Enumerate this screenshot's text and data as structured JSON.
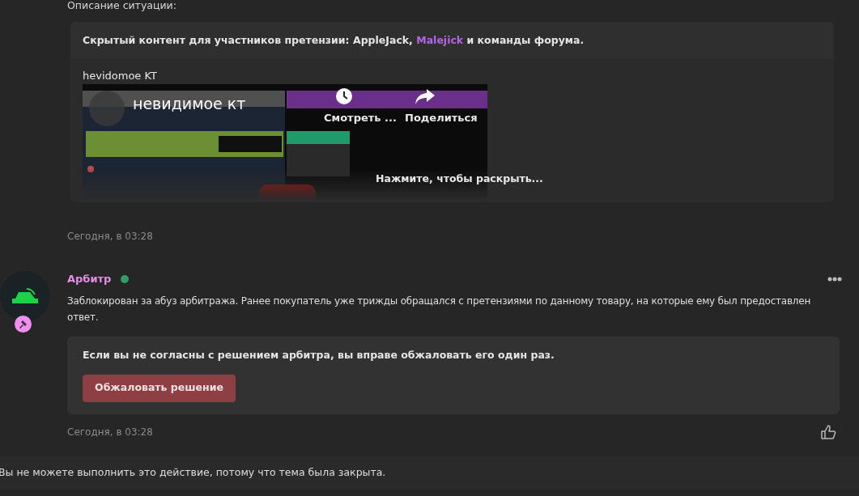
{
  "section_label": "Описание ситуации:",
  "spoiler": {
    "notice": "Скрытый контент для участников претензии: **AppleJack**, ",
    "member": "Malejick",
    "notice_end": " и команды форума.",
    "caption": "hevidomoe KT",
    "video": {
      "title": "невидимое кт",
      "actions": [
        "Смотреть ...",
        "Поделиться"
      ]
    },
    "expand": "Нажмите, чтобы раскрыть..."
  },
  "first_post": {
    "time": "Сегодня, в 03:28"
  },
  "post": {
    "author": "Арбитр",
    "online": true,
    "text": "Заблокирован за абуз арбитража. Ранее покупатель уже трижды обращался с претензиями по данному товару, на которые ему был предоставлен ответ.",
    "appeal": {
      "text": "Если вы не согласны с решением арбитра, вы вправе обжаловать его один раз.",
      "button": "Обжаловать решение"
    },
    "time": "Сегодня, в 03:28"
  },
  "closed_notice": "Вы не можете выполнить это действие, потому что тема была закрыта."
}
